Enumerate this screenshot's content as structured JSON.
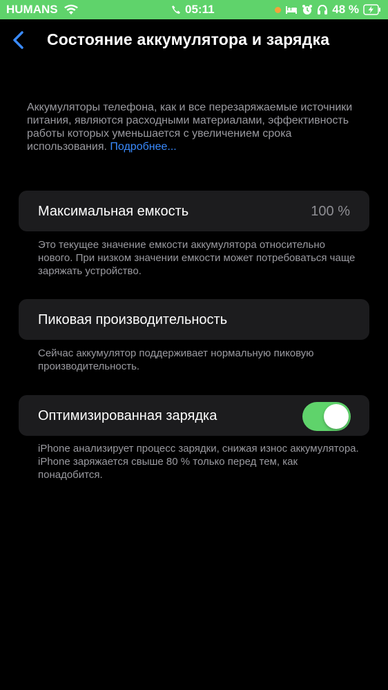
{
  "status_bar": {
    "carrier": "HUMANS",
    "time": "05:11",
    "battery_percent": "48 %",
    "background_color": "#5fd36b",
    "icons": [
      "wifi-icon",
      "phone-icon",
      "orange-dot-icon",
      "bed-icon",
      "alarm-icon",
      "headphones-icon",
      "battery-charging-icon"
    ]
  },
  "nav": {
    "title": "Состояние аккумулятора и зарядка"
  },
  "intro": {
    "text": "Аккумуляторы телефона, как и все перезаряжаемые источники питания, являются расходными материалами, эффективность работы которых уменьшается с увеличением срока использования. ",
    "link": "Подробнее..."
  },
  "max_capacity": {
    "label": "Максимальная емкость",
    "value": "100 %",
    "footer": "Это текущее значение емкости аккумулятора относительно нового. При низком значении емкости может потребоваться чаще заряжать устройство."
  },
  "peak_performance": {
    "label": "Пиковая производительность",
    "footer": "Сейчас аккумулятор поддерживает нормальную пиковую производительность."
  },
  "optimized_charging": {
    "label": "Оптимизированная зарядка",
    "enabled": true,
    "footer": "iPhone анализирует процесс зарядки, снижая износ аккумулятора. iPhone заряжается свыше 80 % только перед тем, как понадобится."
  },
  "colors": {
    "accent_link": "#3a8bff",
    "toggle_on": "#5fd36b",
    "card_bg": "#1c1c1e"
  }
}
